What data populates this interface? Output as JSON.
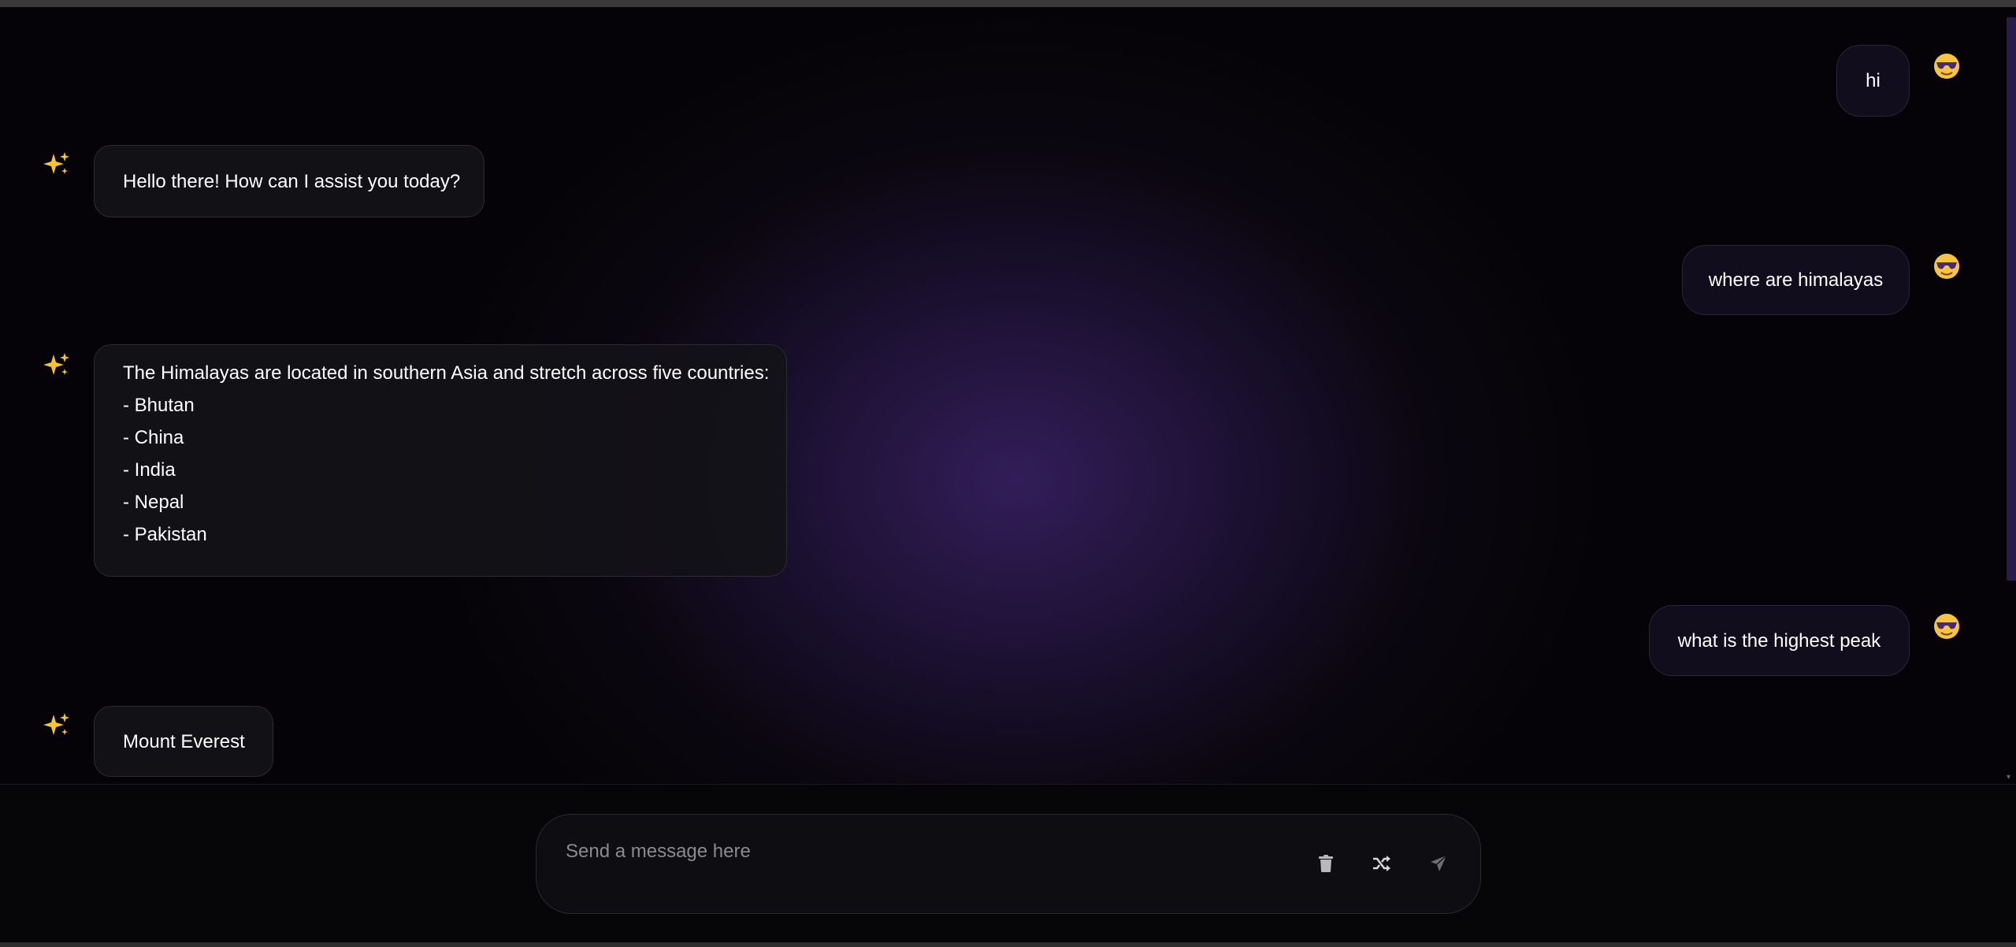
{
  "messages": [
    {
      "role": "user",
      "text": "hi"
    },
    {
      "role": "assistant",
      "text": "Hello there! How can I assist you today?"
    },
    {
      "role": "user",
      "text": "where are himalayas"
    },
    {
      "role": "assistant",
      "lines": [
        "The Himalayas are located in southern Asia and stretch across five countries:",
        "- Bhutan",
        "- China",
        "- India",
        "- Nepal",
        "- Pakistan"
      ]
    },
    {
      "role": "user",
      "text": "what is the highest peak"
    },
    {
      "role": "assistant",
      "text": "Mount Everest"
    }
  ],
  "composer": {
    "placeholder": "Send a message here",
    "value": "",
    "actions": [
      "trash-icon",
      "shuffle-icon",
      "send-icon"
    ]
  },
  "icons": {
    "user_avatar": "sunglasses-face-icon",
    "bot_avatar": "sparkles-icon"
  },
  "colors": {
    "glow": "#331d59",
    "user_bubble": "#120e1e",
    "bot_bubble": "#141218"
  }
}
